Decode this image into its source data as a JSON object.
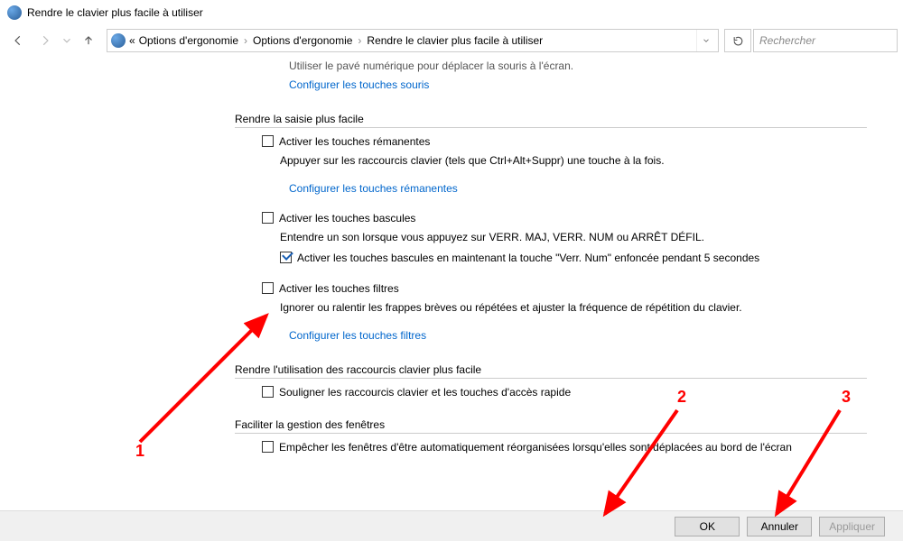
{
  "window": {
    "title": "Rendre le clavier plus facile à utiliser"
  },
  "breadcrumbs": {
    "prefix": "«",
    "items": [
      "Options d'ergonomie",
      "Options d'ergonomie",
      "Rendre le clavier plus facile à utiliser"
    ]
  },
  "search": {
    "placeholder": "Rechercher"
  },
  "truncated_above": {
    "text": "Utiliser le pavé numérique pour déplacer la souris à l'écran.",
    "link": "Configurer les touches souris"
  },
  "section_input": {
    "title": "Rendre la saisie plus facile",
    "sticky": {
      "label": "Activer les touches rémanentes",
      "desc": "Appuyer sur les raccourcis clavier (tels que Ctrl+Alt+Suppr) une touche à la fois.",
      "link": "Configurer les touches rémanentes"
    },
    "toggle": {
      "label": "Activer les touches bascules",
      "desc": "Entendre un son lorsque vous appuyez sur VERR. MAJ, VERR. NUM ou ARRÊT DÉFIL.",
      "hold": "Activer les touches bascules en maintenant la touche \"Verr. Num\" enfoncée pendant 5 secondes"
    },
    "filter": {
      "label": "Activer les touches filtres",
      "desc": "Ignorer ou ralentir les frappes brèves ou répétées et ajuster la fréquence de répétition du clavier.",
      "link": "Configurer les touches filtres"
    }
  },
  "section_shortcuts": {
    "title": "Rendre l'utilisation des raccourcis clavier plus facile",
    "underline": "Souligner les raccourcis clavier et les touches d'accès rapide"
  },
  "section_windows": {
    "title": "Faciliter la gestion des fenêtres",
    "prevent": "Empêcher les fenêtres d'être automatiquement réorganisées lorsqu'elles sont déplacées au bord de l'écran"
  },
  "buttons": {
    "ok": "OK",
    "cancel": "Annuler",
    "apply": "Appliquer"
  },
  "annotations": {
    "n1": "1",
    "n2": "2",
    "n3": "3"
  }
}
